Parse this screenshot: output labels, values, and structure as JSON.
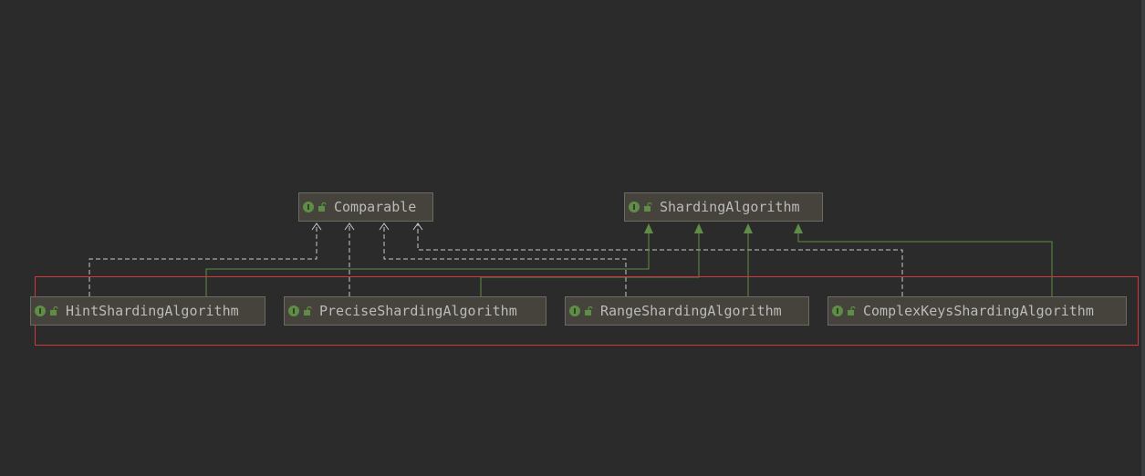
{
  "diagram": {
    "nodes": [
      {
        "id": "comparable",
        "label": "Comparable",
        "kind": "interface",
        "badge": "I"
      },
      {
        "id": "sharding-algorithm",
        "label": "ShardingAlgorithm",
        "kind": "interface",
        "badge": "I"
      },
      {
        "id": "hint-sharding-algorithm",
        "label": "HintShardingAlgorithm",
        "kind": "interface",
        "badge": "I"
      },
      {
        "id": "precise-sharding-algorithm",
        "label": "PreciseShardingAlgorithm",
        "kind": "interface",
        "badge": "I"
      },
      {
        "id": "range-sharding-algorithm",
        "label": "RangeShardingAlgorithm",
        "kind": "interface",
        "badge": "I"
      },
      {
        "id": "complex-keys-sharding-algorithm",
        "label": "ComplexKeysShardingAlgorithm",
        "kind": "interface",
        "badge": "I"
      }
    ],
    "edges": [
      {
        "from": "hint-sharding-algorithm",
        "to": "comparable",
        "type": "dependency"
      },
      {
        "from": "precise-sharding-algorithm",
        "to": "comparable",
        "type": "dependency"
      },
      {
        "from": "range-sharding-algorithm",
        "to": "comparable",
        "type": "dependency"
      },
      {
        "from": "complex-keys-sharding-algorithm",
        "to": "comparable",
        "type": "dependency"
      },
      {
        "from": "hint-sharding-algorithm",
        "to": "sharding-algorithm",
        "type": "extends"
      },
      {
        "from": "precise-sharding-algorithm",
        "to": "sharding-algorithm",
        "type": "extends"
      },
      {
        "from": "range-sharding-algorithm",
        "to": "sharding-algorithm",
        "type": "extends"
      },
      {
        "from": "complex-keys-sharding-algorithm",
        "to": "sharding-algorithm",
        "type": "extends"
      }
    ]
  },
  "colors": {
    "background": "#2b2b2b",
    "node_fill": "#45433c",
    "node_border": "#6b6b64",
    "node_text": "#bbbbbb",
    "interface_badge": "#5f8d47",
    "extends_edge": "#5f8d47",
    "dependency_edge": "#c8c8c8",
    "selection": "#d0393b"
  },
  "icons": {
    "interface_badge": "interface-icon",
    "visibility": "lock-icon"
  }
}
